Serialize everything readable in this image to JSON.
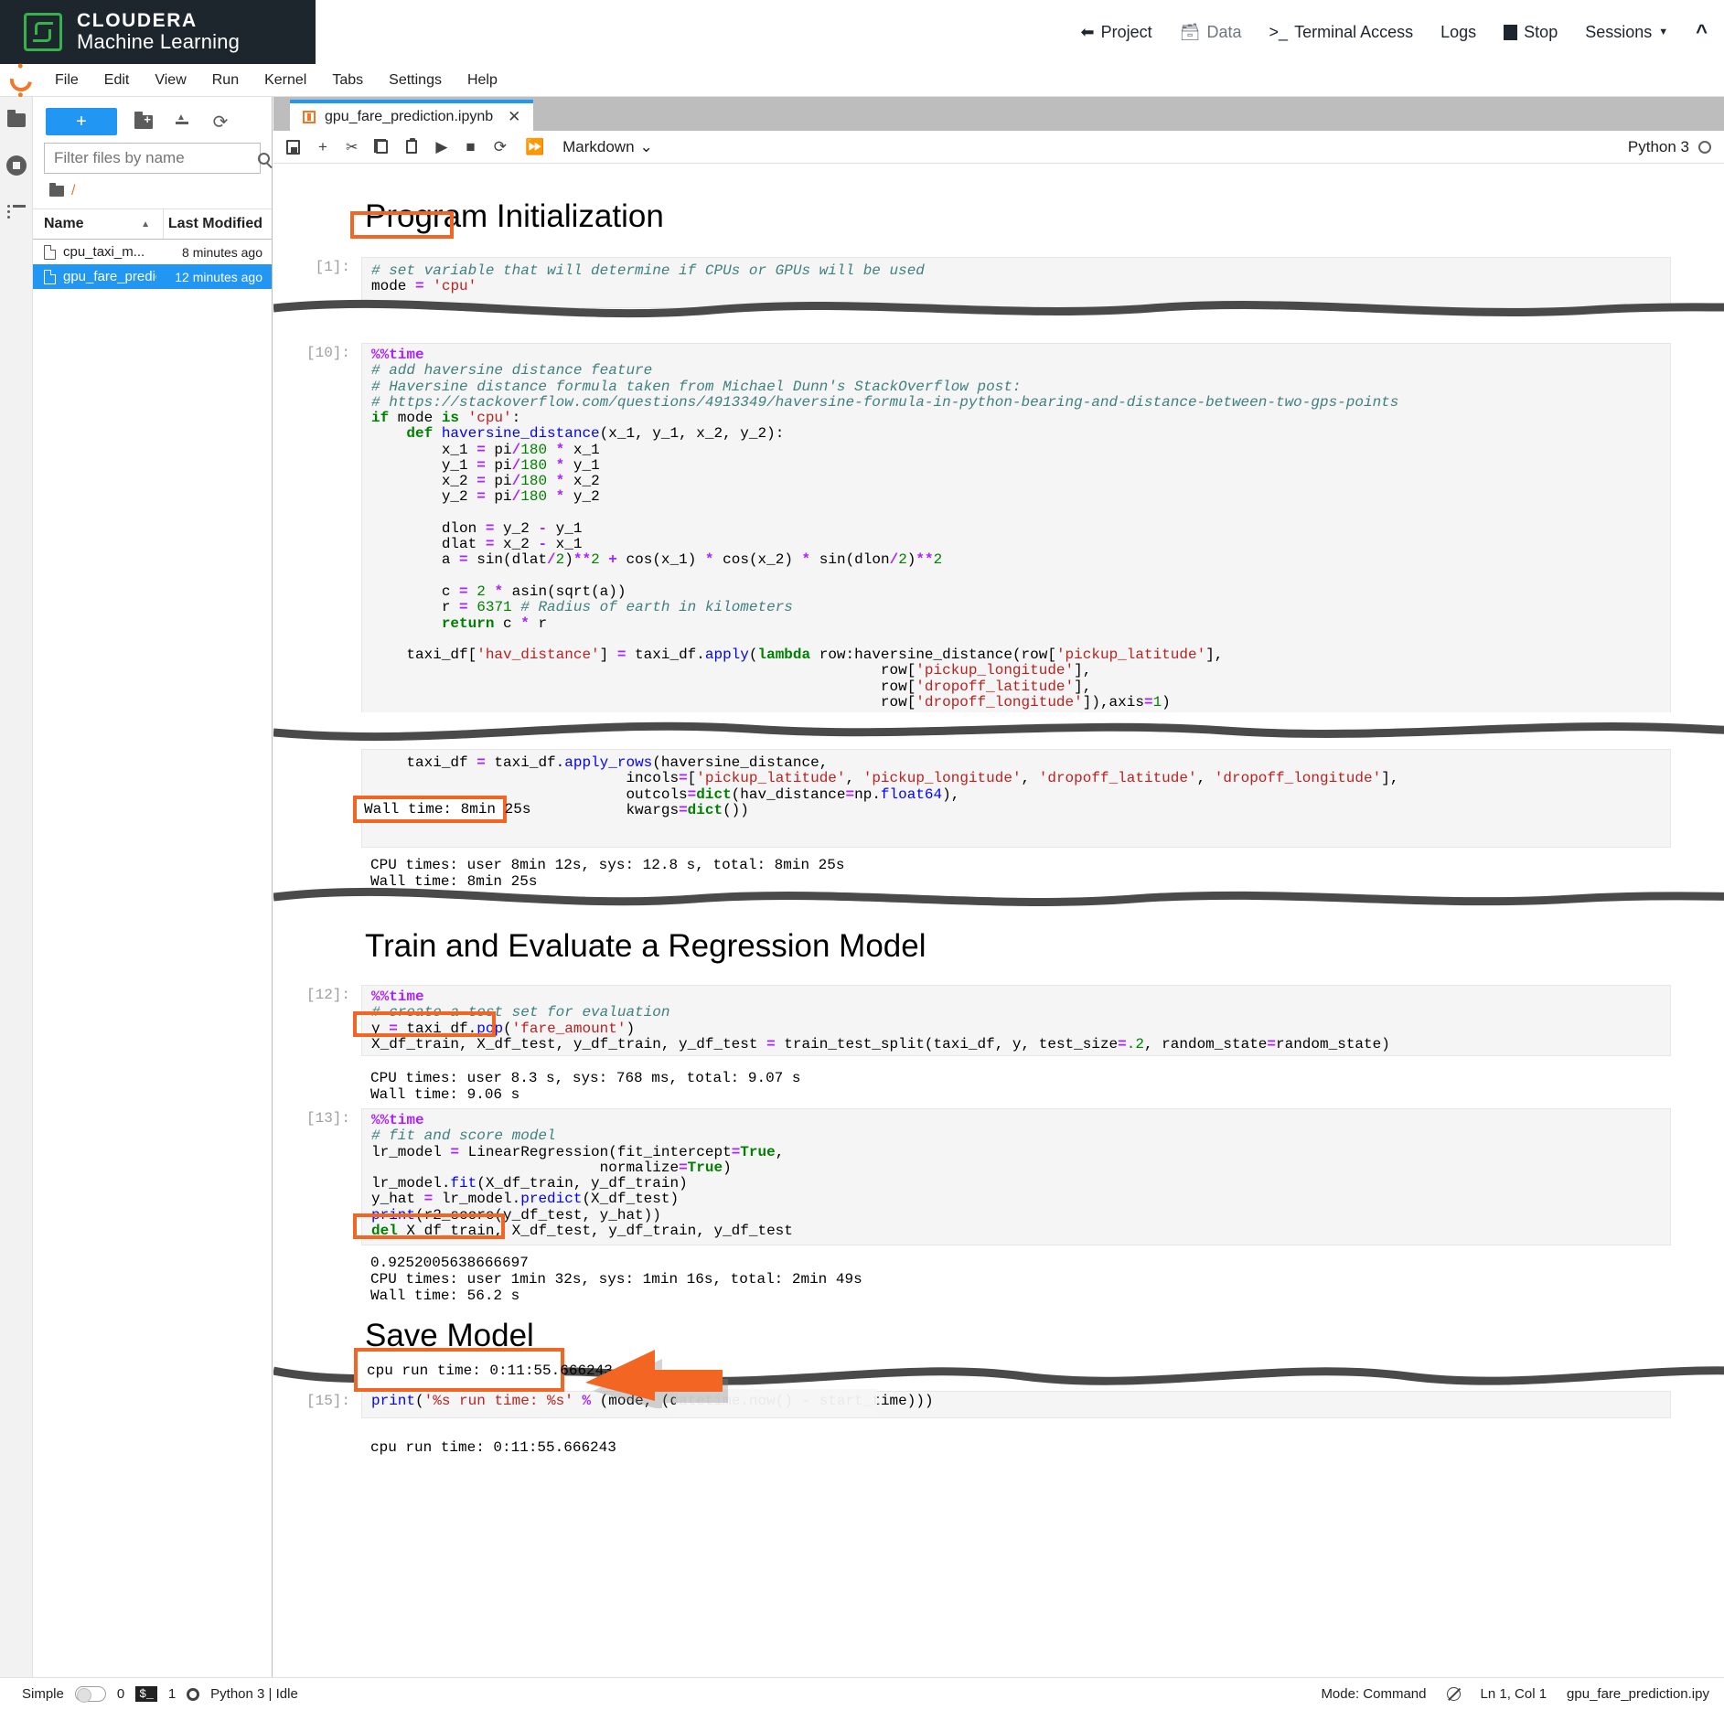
{
  "cml": {
    "brand_line1": "CLOUDERA",
    "brand_line2": "Machine Learning",
    "nav": [
      {
        "label": "Project",
        "icon": "back-arrow-icon"
      },
      {
        "label": "Data",
        "icon": "database-icon"
      },
      {
        "label": "Terminal Access",
        "icon": "terminal-icon"
      },
      {
        "label": "Logs",
        "icon": ""
      },
      {
        "label": "Stop",
        "icon": "stop-square-icon"
      },
      {
        "label": "Sessions",
        "icon": "caret-down-icon"
      }
    ],
    "collapse_icon": "chevron-up-icon"
  },
  "menubar": {
    "items": [
      "File",
      "Edit",
      "View",
      "Run",
      "Kernel",
      "Tabs",
      "Settings",
      "Help"
    ]
  },
  "filebrowser": {
    "new_button_label": "+",
    "icons": [
      "new-folder-icon",
      "upload-icon",
      "refresh-icon"
    ],
    "filter_placeholder": "Filter files by name",
    "filter_value": "",
    "breadcrumb": "/",
    "columns": [
      "Name",
      "Last Modified"
    ],
    "rows": [
      {
        "name": "cpu_taxi_m...",
        "modified": "8 minutes ago",
        "selected": false
      },
      {
        "name": "gpu_fare_prediction.ipynb",
        "modified": "12 minutes ago",
        "selected": true
      }
    ]
  },
  "notebook": {
    "tab_title": "gpu_fare_prediction.ipynb",
    "close_label": "✕",
    "toolbar_icons": [
      "save-icon",
      "add-cell-icon",
      "cut-icon",
      "copy-icon",
      "paste-icon",
      "run-icon",
      "stop-icon",
      "restart-icon",
      "restart-run-all-icon"
    ],
    "cell_type": "Markdown",
    "kernel_name": "Python 3",
    "kernel_status": "idle"
  },
  "cells": {
    "h1_program_init": "Program Initialization",
    "h1_train_eval": "Train and Evaluate a Regression Model",
    "h1_save_model": "Save Model",
    "c1_prompt": "[1]:",
    "c1_comment": "# set variable that will determine if CPUs or GPUs will be used",
    "c1_mode_var": "mode",
    "c1_mode_op": "=",
    "c1_mode_val": "'cpu'",
    "c10_prompt": "[10]:",
    "c12_prompt": "[12]:",
    "c13_prompt": "[13]:",
    "c15_prompt": "[15]:",
    "out_wall_1": "Wall time: 8min 25s",
    "out_cpu_1": "CPU times: user 8min 12s, sys: 12.8 s, total: 8min 25s",
    "out_cpu_12": "CPU times: user 8.3 s, sys: 768 ms, total: 9.07 s",
    "out_wall_12": "Wall time: 9.06 s",
    "out_r2": "0.9252005638666697",
    "out_cpu_13": "CPU times: user 1min 32s, sys: 1min 16s, total: 2min 49s",
    "out_wall_13": "Wall time: 56.2 s",
    "out_runtime": "cpu run time: 0:11:55.666243"
  },
  "statusbar": {
    "simple_label": "Simple",
    "count_0": "0",
    "kernel_badge": "$_",
    "count_1": "1",
    "gear": "gear-icon",
    "kernel_state": "Python 3 | Idle",
    "mode": "Mode: Command",
    "bug_icon": "bug-disabled-icon",
    "cursor": "Ln 1, Col 1",
    "filename": "gpu_fare_prediction.ipy"
  },
  "annotations": {
    "accent_color": "#f26522",
    "highlight_boxes": [
      "mode = 'cpu'",
      "Wall time: 8min 25s",
      "Wall time: 9.06 s",
      "Wall time: 56.2 s",
      "cpu run time: 0:11:55.666243"
    ],
    "arrow": "right-pointing-arrow"
  }
}
